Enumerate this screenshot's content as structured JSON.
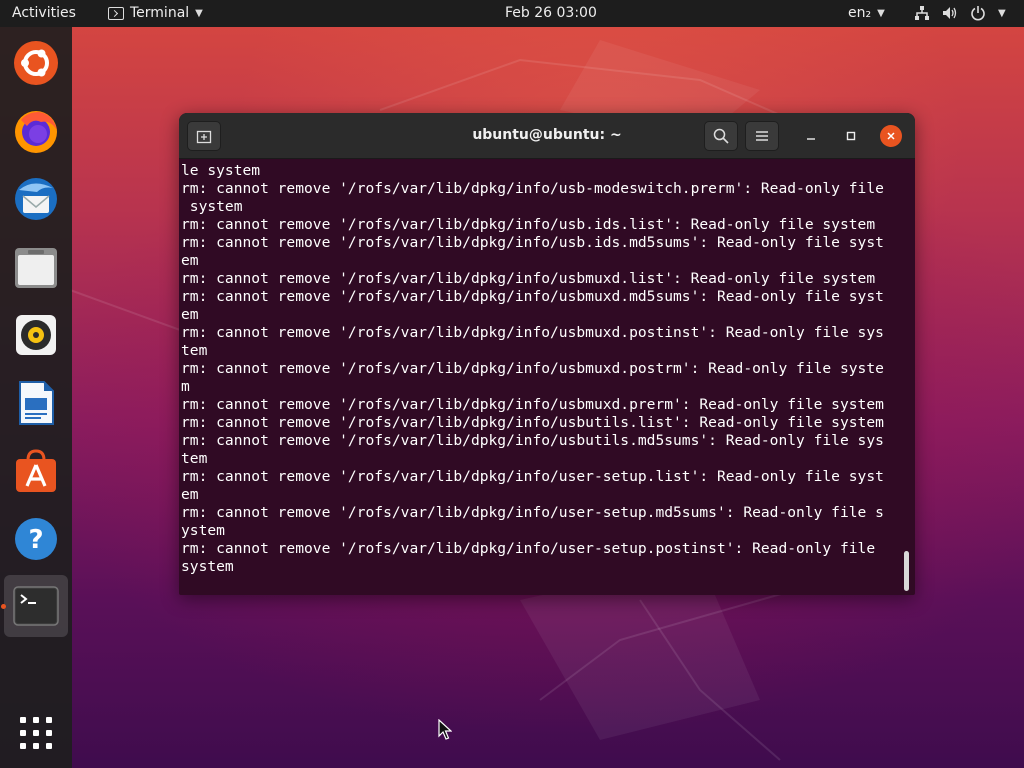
{
  "topbar": {
    "activities": "Activities",
    "app_name": "Terminal",
    "clock": "Feb 26  03:00",
    "language": "en₂"
  },
  "dock": {
    "items": [
      {
        "name": "ubuntu-installer-icon"
      },
      {
        "name": "firefox-icon"
      },
      {
        "name": "thunderbird-icon"
      },
      {
        "name": "files-icon"
      },
      {
        "name": "rhythmbox-icon"
      },
      {
        "name": "libreoffice-writer-icon"
      },
      {
        "name": "software-center-icon"
      },
      {
        "name": "help-icon"
      },
      {
        "name": "terminal-icon"
      }
    ],
    "show_apps": "show-applications-icon"
  },
  "terminal": {
    "title": "ubuntu@ubuntu: ~",
    "lines": [
      "le system",
      "rm: cannot remove '/rofs/var/lib/dpkg/info/usb-modeswitch.prerm': Read-only file",
      " system",
      "rm: cannot remove '/rofs/var/lib/dpkg/info/usb.ids.list': Read-only file system",
      "rm: cannot remove '/rofs/var/lib/dpkg/info/usb.ids.md5sums': Read-only file syst",
      "em",
      "rm: cannot remove '/rofs/var/lib/dpkg/info/usbmuxd.list': Read-only file system",
      "rm: cannot remove '/rofs/var/lib/dpkg/info/usbmuxd.md5sums': Read-only file syst",
      "em",
      "rm: cannot remove '/rofs/var/lib/dpkg/info/usbmuxd.postinst': Read-only file sys",
      "tem",
      "rm: cannot remove '/rofs/var/lib/dpkg/info/usbmuxd.postrm': Read-only file syste",
      "m",
      "rm: cannot remove '/rofs/var/lib/dpkg/info/usbmuxd.prerm': Read-only file system",
      "rm: cannot remove '/rofs/var/lib/dpkg/info/usbutils.list': Read-only file system",
      "rm: cannot remove '/rofs/var/lib/dpkg/info/usbutils.md5sums': Read-only file sys",
      "tem",
      "rm: cannot remove '/rofs/var/lib/dpkg/info/user-setup.list': Read-only file syst",
      "em",
      "rm: cannot remove '/rofs/var/lib/dpkg/info/user-setup.md5sums': Read-only file s",
      "ystem",
      "rm: cannot remove '/rofs/var/lib/dpkg/info/user-setup.postinst': Read-only file",
      "system"
    ]
  },
  "colors": {
    "accent": "#e95420",
    "terminal_bg": "#300a24",
    "topbar_bg": "#1d1d1d"
  }
}
